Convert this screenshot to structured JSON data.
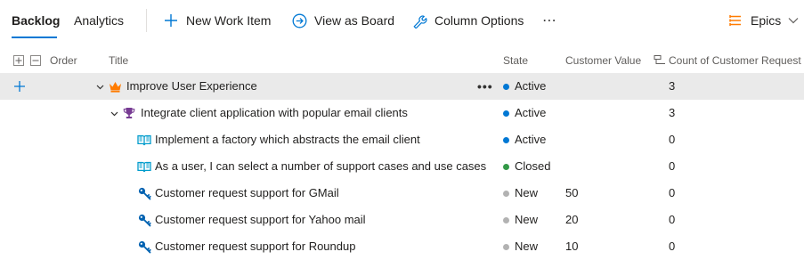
{
  "tabs": {
    "backlog": "Backlog",
    "analytics": "Analytics"
  },
  "toolbar": {
    "new_work_item": "New Work Item",
    "view_as_board": "View as Board",
    "column_options": "Column Options",
    "more": "⋯",
    "level_selector": "Epics"
  },
  "columns": {
    "order": "Order",
    "title": "Title",
    "state": "State",
    "customer_value": "Customer Value",
    "count": "Count of Customer Request"
  },
  "rows": [
    {
      "title": "Improve User Experience",
      "type": "epic",
      "icon": "crown-icon",
      "state": "Active",
      "customer_value": "",
      "count": "3"
    },
    {
      "title": "Integrate client application with popular email clients",
      "type": "feature",
      "icon": "trophy-icon",
      "state": "Active",
      "customer_value": "",
      "count": "3"
    },
    {
      "title": "Implement a factory which abstracts the email client",
      "type": "user-story",
      "icon": "book-icon",
      "state": "Active",
      "customer_value": "",
      "count": "0"
    },
    {
      "title": "As a user, I can select a number of support cases and use cases",
      "type": "user-story",
      "icon": "book-icon",
      "state": "Closed",
      "customer_value": "",
      "count": "0"
    },
    {
      "title": "Customer request support for GMail",
      "type": "customer-request",
      "icon": "key-icon",
      "state": "New",
      "customer_value": "50",
      "count": "0"
    },
    {
      "title": "Customer request support for Yahoo mail",
      "type": "customer-request",
      "icon": "key-icon",
      "state": "New",
      "customer_value": "20",
      "count": "0"
    },
    {
      "title": "Customer request support for Roundup",
      "type": "customer-request",
      "icon": "key-icon",
      "state": "New",
      "customer_value": "10",
      "count": "0"
    }
  ],
  "colors": {
    "accent": "#0078d4",
    "state_active": "#0078d4",
    "state_closed": "#339947",
    "state_new": "#b2b2b2",
    "epic": "#ff7b00",
    "feature": "#773b93",
    "user_story": "#009ccc",
    "customer_request": "#0062b1",
    "selected_row": "#eaeaea"
  }
}
